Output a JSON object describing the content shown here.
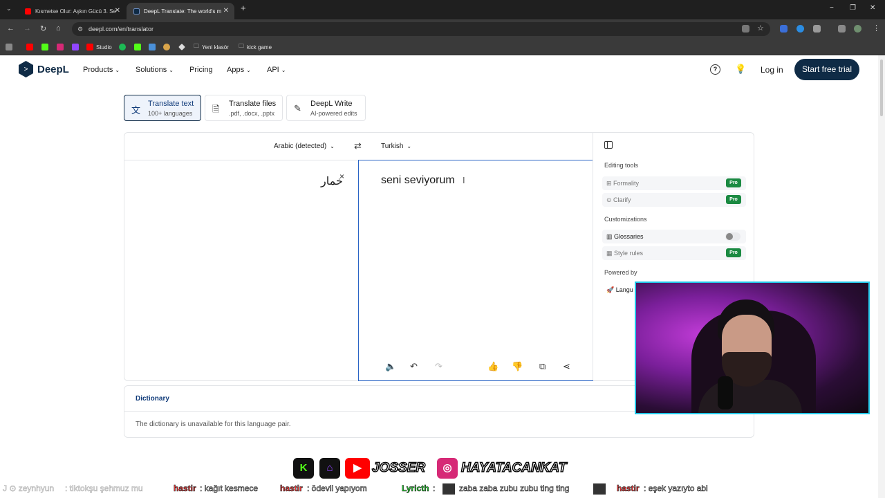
{
  "browser": {
    "tabs": [
      {
        "title": "Kısmetse Olur: Aşkın Gücü 3. Se",
        "favicon_color": "#ff0000"
      },
      {
        "title": "DeepL Translate: The world's m",
        "favicon_color": "#0f2b46"
      }
    ],
    "new_tab": "+",
    "window_controls": [
      "−",
      "❐",
      "✕"
    ],
    "url": "deepl.com/en/translator",
    "bookmarks": [
      "Studio",
      "Yeni klasör",
      "kick game"
    ]
  },
  "header": {
    "logo_text": "DeepL",
    "nav": [
      "Products",
      "Solutions",
      "Pricing",
      "Apps",
      "API"
    ],
    "login": "Log in",
    "cta": "Start free trial"
  },
  "modes": [
    {
      "title": "Translate text",
      "subtitle": "100+ languages"
    },
    {
      "title": "Translate files",
      "subtitle": ".pdf, .docx, .pptx"
    },
    {
      "title": "DeepL Write",
      "subtitle": "AI-powered edits"
    }
  ],
  "translator": {
    "source_lang": "Arabic (detected)",
    "target_lang": "Turkish",
    "source_text": "خمار",
    "target_text": "seni seviyorum",
    "clear": "×"
  },
  "sidebar": {
    "editing_title": "Editing tools",
    "formality": "Formality",
    "clarify": "Clarify",
    "customizations_title": "Customizations",
    "glossaries": "Glossaries",
    "style_rules": "Style rules",
    "powered_title": "Powered by",
    "powered_item": "Langu",
    "pro": "Pro"
  },
  "dictionary": {
    "title": "Dictionary",
    "message": "The dictionary is unavailable for this language pair."
  },
  "overlay": {
    "brand_1": "JOSSER",
    "brand_2": "HAYATACANKAT",
    "ticker": [
      {
        "user": "J ⊙ zeynhyun",
        "text": ": tiktokşu şehmuz mu",
        "faint": true
      },
      {
        "user": "hastir",
        "text": ": kağıt kesmece"
      },
      {
        "user": "hastir",
        "text": ": ödevli yapıyom"
      },
      {
        "user": "Lyricth",
        "text": ":"
      },
      {
        "user": "",
        "text": "zaba zaba zubu zubu ting ting"
      },
      {
        "user": "hastir",
        "text": ": eşek yazıyto abi"
      }
    ]
  }
}
